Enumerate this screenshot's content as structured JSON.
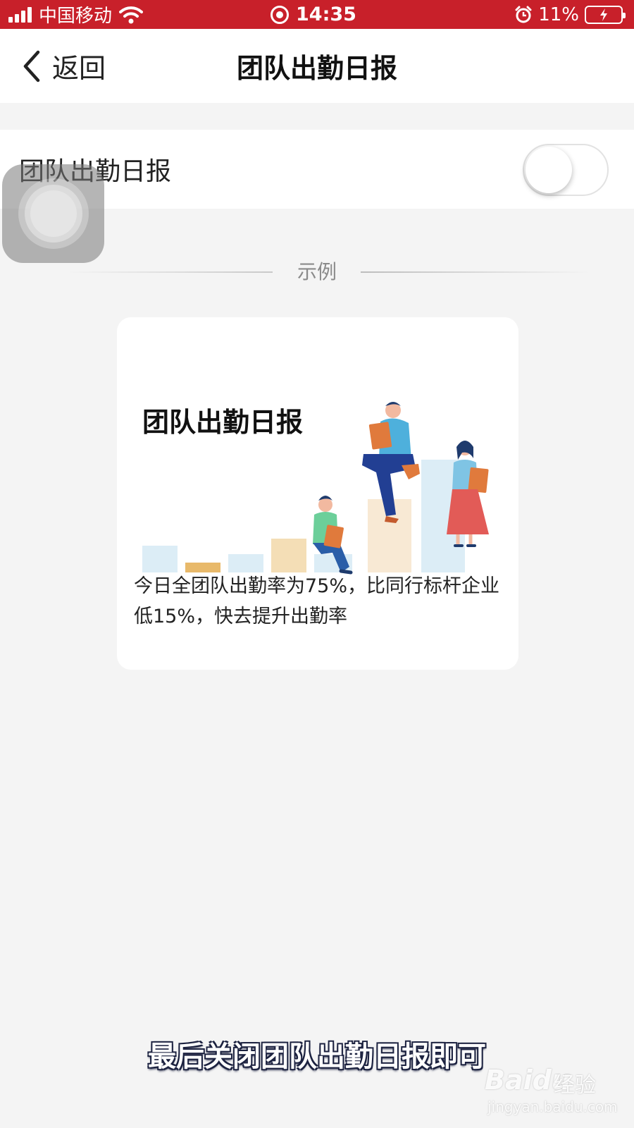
{
  "status_bar": {
    "carrier": "中国移动",
    "time": "14:35",
    "battery": "11%",
    "icons": [
      "signal-icon",
      "wifi-icon",
      "screen-record-icon",
      "alarm-icon",
      "battery-charging-icon"
    ],
    "background_color": "#c8202a"
  },
  "nav": {
    "back_label": "返回",
    "title": "团队出勤日报"
  },
  "setting": {
    "label": "团队出勤日报",
    "toggle_on": false
  },
  "example": {
    "divider_label": "示例",
    "card": {
      "title": "团队出勤日报",
      "description": "今日全团队出勤率为75%，比同行标杆企业低15%，快去提升出勤率"
    }
  },
  "subtitle": "最后关闭团队出勤日报即可",
  "watermark": {
    "logo": "Baidu",
    "sub": "经验",
    "url": "jingyan.baidu.com"
  },
  "colors": {
    "accent_red": "#c8202a",
    "page_bg": "#f4f4f4"
  }
}
